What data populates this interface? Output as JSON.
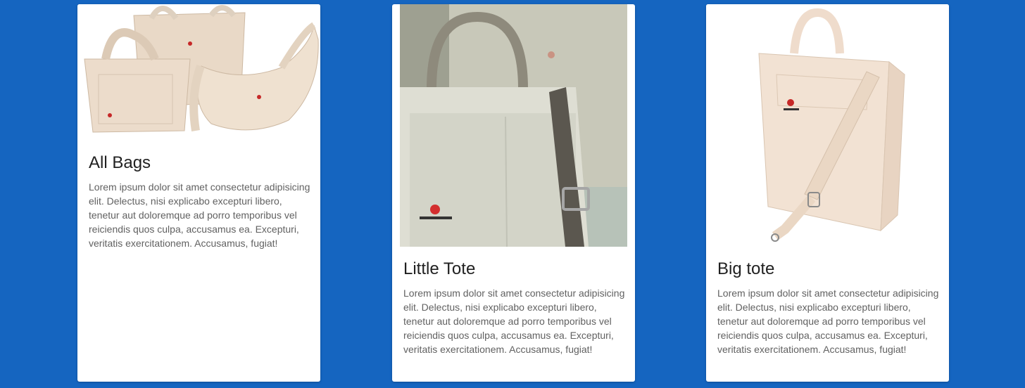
{
  "colors": {
    "background": "#1565c0",
    "card": "#ffffff",
    "title": "#212121",
    "text": "#616161"
  },
  "cards": [
    {
      "title": "All Bags",
      "description": "Lorem ipsum dolor sit amet consectetur adipisicing elit. Delectus, nisi explicabo excepturi libero, tenetur aut doloremque ad porro temporibus vel reiciendis quos culpa, accusamus ea. Excepturi, veritatis exercitationem. Accusamus, fugiat!",
      "image": "bags-group-photo"
    },
    {
      "title": "Little Tote",
      "description": "Lorem ipsum dolor sit amet consectetur adipisicing elit. Delectus, nisi explicabo excepturi libero, tenetur aut doloremque ad porro temporibus vel reiciendis quos culpa, accusamus ea. Excepturi, veritatis exercitationem. Accusamus, fugiat!",
      "image": "little-tote-photo"
    },
    {
      "title": "Big tote",
      "description": "Lorem ipsum dolor sit amet consectetur adipisicing elit. Delectus, nisi explicabo excepturi libero, tenetur aut doloremque ad porro temporibus vel reiciendis quos culpa, accusamus ea. Excepturi, veritatis exercitationem. Accusamus, fugiat!",
      "image": "big-tote-photo"
    }
  ]
}
